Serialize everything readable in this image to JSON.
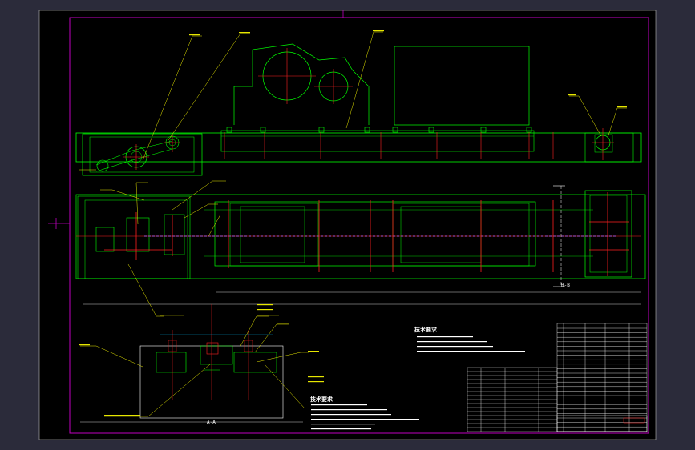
{
  "drawing": {
    "section_a_label": "A-A",
    "section_b_label": "B-B",
    "tech_notes_upper_title": "技术要求",
    "tech_notes_lower_title": "技术要求"
  },
  "colors": {
    "background": "#000000",
    "outline": "#00ff00",
    "centerline": "#ff2020",
    "leader": "#ffff00",
    "border": "#c000c0",
    "dimension": "#00c0ff",
    "text": "#ffffff"
  }
}
